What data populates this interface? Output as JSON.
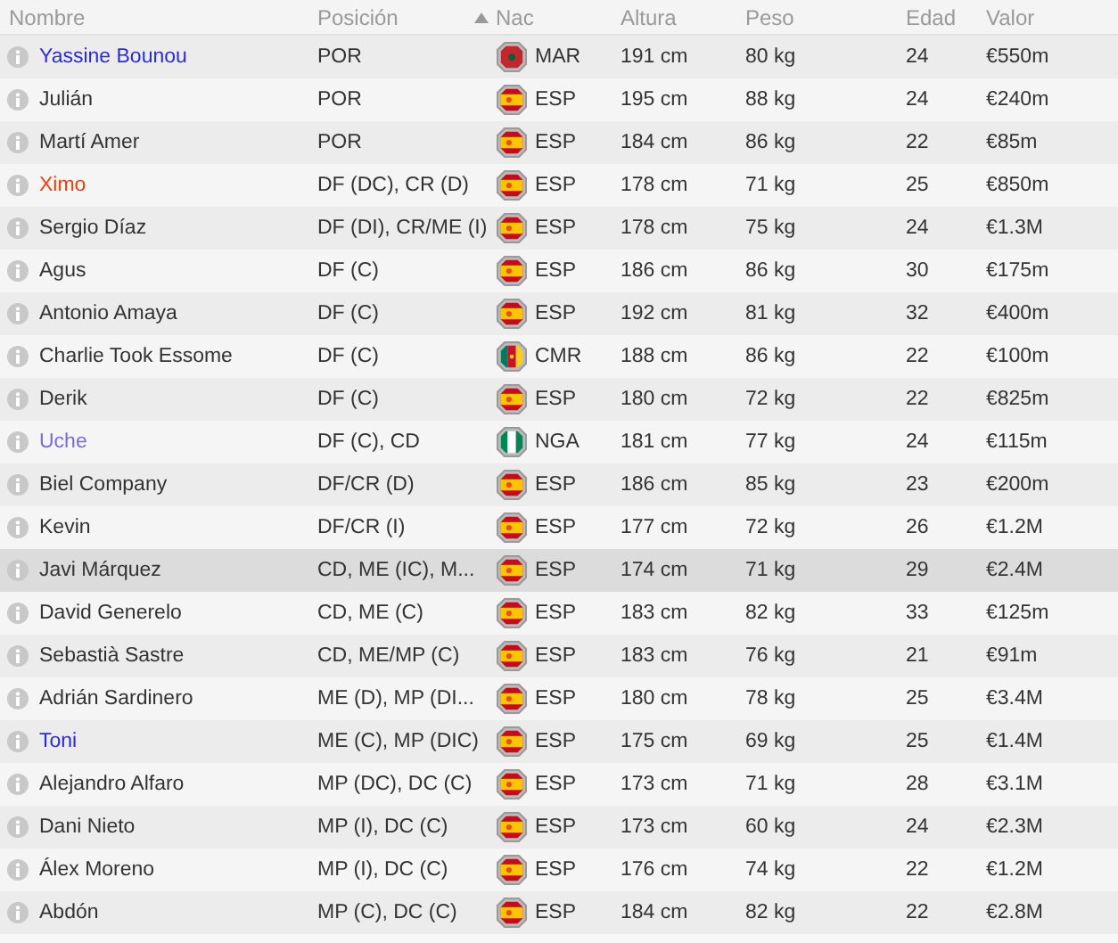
{
  "columns": [
    {
      "label": "Nombre",
      "sorted": false
    },
    {
      "label": "Posición",
      "sorted": false
    },
    {
      "label": "Nac",
      "sorted": true
    },
    {
      "label": "Altura",
      "sorted": false
    },
    {
      "label": "Peso",
      "sorted": false
    },
    {
      "label": "Edad",
      "sorted": false
    },
    {
      "label": "Valor",
      "sorted": false
    }
  ],
  "rows": [
    {
      "name": "Yassine Bounou",
      "color": "#2b2bd6",
      "position": "POR",
      "kind": "mar",
      "nat": "MAR",
      "height": "191 cm",
      "weight": "80 kg",
      "age": "24",
      "value": "€550m",
      "selected": false
    },
    {
      "name": "Julián",
      "color": "#333333",
      "position": "POR",
      "kind": "esp",
      "nat": "ESP",
      "height": "195 cm",
      "weight": "88 kg",
      "age": "24",
      "value": "€240m",
      "selected": false
    },
    {
      "name": "Martí Amer",
      "color": "#333333",
      "position": "POR",
      "kind": "esp",
      "nat": "ESP",
      "height": "184 cm",
      "weight": "86 kg",
      "age": "22",
      "value": "€85m",
      "selected": false
    },
    {
      "name": "Ximo",
      "color": "#e8400c",
      "position": "DF (DC), CR (D)",
      "kind": "esp",
      "nat": "ESP",
      "height": "178 cm",
      "weight": "71 kg",
      "age": "25",
      "value": "€850m",
      "selected": false
    },
    {
      "name": "Sergio Díaz",
      "color": "#333333",
      "position": "DF (DI), CR/ME (I)",
      "kind": "esp",
      "nat": "ESP",
      "height": "178 cm",
      "weight": "75 kg",
      "age": "24",
      "value": "€1.3M",
      "selected": false
    },
    {
      "name": "Agus",
      "color": "#333333",
      "position": "DF (C)",
      "kind": "esp",
      "nat": "ESP",
      "height": "186 cm",
      "weight": "86 kg",
      "age": "30",
      "value": "€175m",
      "selected": false
    },
    {
      "name": "Antonio Amaya",
      "color": "#333333",
      "position": "DF (C)",
      "kind": "esp",
      "nat": "ESP",
      "height": "192 cm",
      "weight": "81 kg",
      "age": "32",
      "value": "€400m",
      "selected": false
    },
    {
      "name": "Charlie Took Essome",
      "color": "#333333",
      "position": "DF (C)",
      "kind": "cmr",
      "nat": "CMR",
      "height": "188 cm",
      "weight": "86 kg",
      "age": "22",
      "value": "€100m",
      "selected": false
    },
    {
      "name": "Derik",
      "color": "#333333",
      "position": "DF (C)",
      "kind": "esp",
      "nat": "ESP",
      "height": "180 cm",
      "weight": "72 kg",
      "age": "22",
      "value": "€825m",
      "selected": false
    },
    {
      "name": "Uche",
      "color": "#7b6ad8",
      "position": "DF (C), CD",
      "kind": "nga",
      "nat": "NGA",
      "height": "181 cm",
      "weight": "77 kg",
      "age": "24",
      "value": "€115m",
      "selected": false
    },
    {
      "name": "Biel Company",
      "color": "#333333",
      "position": "DF/CR (D)",
      "kind": "esp",
      "nat": "ESP",
      "height": "186 cm",
      "weight": "85 kg",
      "age": "23",
      "value": "€200m",
      "selected": false
    },
    {
      "name": "Kevin",
      "color": "#333333",
      "position": "DF/CR (I)",
      "kind": "esp",
      "nat": "ESP",
      "height": "177 cm",
      "weight": "72 kg",
      "age": "26",
      "value": "€1.2M",
      "selected": false
    },
    {
      "name": "Javi Márquez",
      "color": "#333333",
      "position": "CD, ME (IC), M...",
      "kind": "esp",
      "nat": "ESP",
      "height": "174 cm",
      "weight": "71 kg",
      "age": "29",
      "value": "€2.4M",
      "selected": true
    },
    {
      "name": "David Generelo",
      "color": "#333333",
      "position": "CD, ME (C)",
      "kind": "esp",
      "nat": "ESP",
      "height": "183 cm",
      "weight": "82 kg",
      "age": "33",
      "value": "€125m",
      "selected": false
    },
    {
      "name": "Sebastià Sastre",
      "color": "#333333",
      "position": "CD, ME/MP (C)",
      "kind": "esp",
      "nat": "ESP",
      "height": "183 cm",
      "weight": "76 kg",
      "age": "21",
      "value": "€91m",
      "selected": false
    },
    {
      "name": "Adrián Sardinero",
      "color": "#333333",
      "position": "ME (D), MP (DI...",
      "kind": "esp",
      "nat": "ESP",
      "height": "180 cm",
      "weight": "78 kg",
      "age": "25",
      "value": "€3.4M",
      "selected": false
    },
    {
      "name": "Toni",
      "color": "#2b2bd6",
      "position": "ME (C), MP (DIC)",
      "kind": "esp",
      "nat": "ESP",
      "height": "175 cm",
      "weight": "69 kg",
      "age": "25",
      "value": "€1.4M",
      "selected": false
    },
    {
      "name": "Alejandro Alfaro",
      "color": "#333333",
      "position": "MP (DC), DC (C)",
      "kind": "esp",
      "nat": "ESP",
      "height": "173 cm",
      "weight": "71 kg",
      "age": "28",
      "value": "€3.1M",
      "selected": false
    },
    {
      "name": "Dani Nieto",
      "color": "#333333",
      "position": "MP (I), DC (C)",
      "kind": "esp",
      "nat": "ESP",
      "height": "173 cm",
      "weight": "60 kg",
      "age": "24",
      "value": "€2.3M",
      "selected": false
    },
    {
      "name": "Álex Moreno",
      "color": "#333333",
      "position": "MP (I), DC (C)",
      "kind": "esp",
      "nat": "ESP",
      "height": "176 cm",
      "weight": "74 kg",
      "age": "22",
      "value": "€1.2M",
      "selected": false
    },
    {
      "name": "Abdón",
      "color": "#333333",
      "position": "MP (C), DC (C)",
      "kind": "esp",
      "nat": "ESP",
      "height": "184 cm",
      "weight": "82 kg",
      "age": "22",
      "value": "€2.8M",
      "selected": false
    }
  ]
}
